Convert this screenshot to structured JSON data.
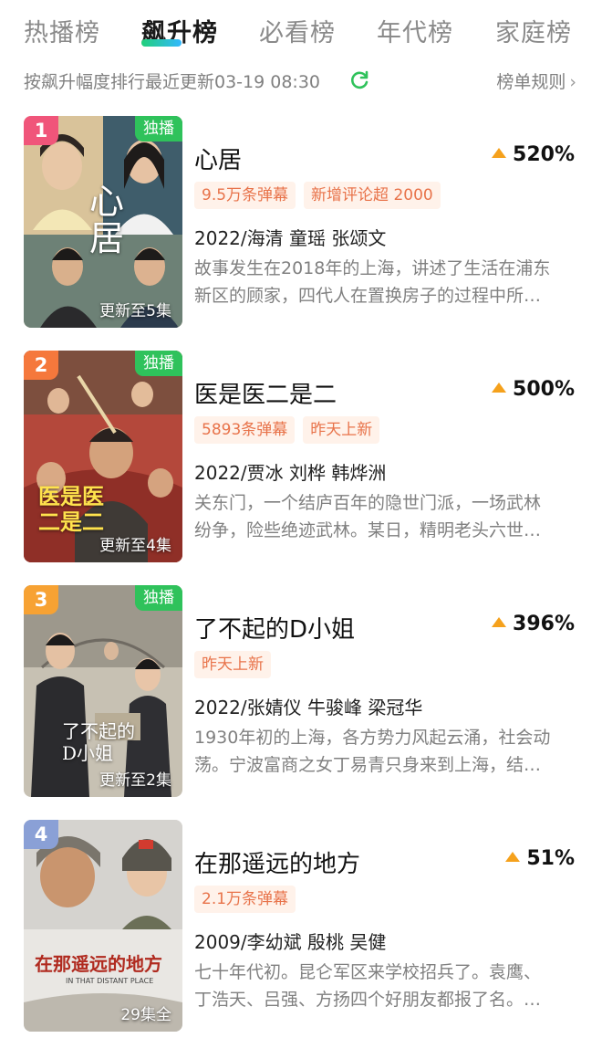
{
  "tabs": [
    {
      "label": "热播榜",
      "active": false
    },
    {
      "label": "飙升榜",
      "active": true
    },
    {
      "label": "必看榜",
      "active": false
    },
    {
      "label": "年代榜",
      "active": false
    },
    {
      "label": "家庭榜",
      "active": false
    }
  ],
  "subheader": {
    "sort_text": "按飙升幅度排行最近更新03-19 08:30",
    "rules_label": "榜单规则",
    "refresh_icon": "refresh-icon",
    "chevron_icon": "chevron-right-icon",
    "accent_color": "#2fc25b"
  },
  "items": [
    {
      "rank": "1",
      "rank_color": "#f0557a",
      "exclusive": "独播",
      "update": "更新至5集",
      "poster_title": "心居",
      "title": "心居",
      "growth": "520%",
      "tags": [
        "9.5万条弹幕",
        "新增评论超 2000"
      ],
      "cast": "2022/海清  童瑶  张颂文",
      "desc_lines": [
        "故事发生在2018年的上海，讲述了生活在浦东",
        "新区的顾家，四代人在置换房子的过程中所…"
      ]
    },
    {
      "rank": "2",
      "rank_color": "#f5783c",
      "exclusive": "独播",
      "update": "更新至4集",
      "poster_title": "医是医二是二",
      "title": "医是医二是二",
      "growth": "500%",
      "tags": [
        "5893条弹幕",
        "昨天上新"
      ],
      "cast": "2022/贾冰  刘桦  韩烨洲",
      "desc_lines": [
        " 关东门，一个结庐百年的隐世门派，一场武林",
        "纷争，险些绝迹武林。某日，精明老头六世…"
      ]
    },
    {
      "rank": "3",
      "rank_color": "#f7a233",
      "exclusive": "独播",
      "update": "更新至2集",
      "poster_title": "了不起的D小姐",
      "title": "了不起的D小姐",
      "growth": "396%",
      "tags": [
        "昨天上新"
      ],
      "cast": "2022/张婧仪  牛骏峰  梁冠华",
      "desc_lines": [
        "1930年初的上海，各方势力风起云涌，社会动",
        "荡。宁波富商之女丁易青只身来到上海，结…"
      ]
    },
    {
      "rank": "4",
      "rank_color": "#8aa0d6",
      "exclusive": "",
      "update": "29集全",
      "poster_title": "在那遥远的地方",
      "poster_subtitle": "IN THAT DISTANT PLACE",
      "title": "在那遥远的地方",
      "growth": "51%",
      "tags": [
        "2.1万条弹幕"
      ],
      "cast": "2009/李幼斌  殷桃  吴健",
      "desc_lines": [
        "七十年代初。昆仑军区来学校招兵了。袁鹰、",
        "丁浩天、吕强、方扬四个好朋友都报了名。…"
      ]
    }
  ]
}
